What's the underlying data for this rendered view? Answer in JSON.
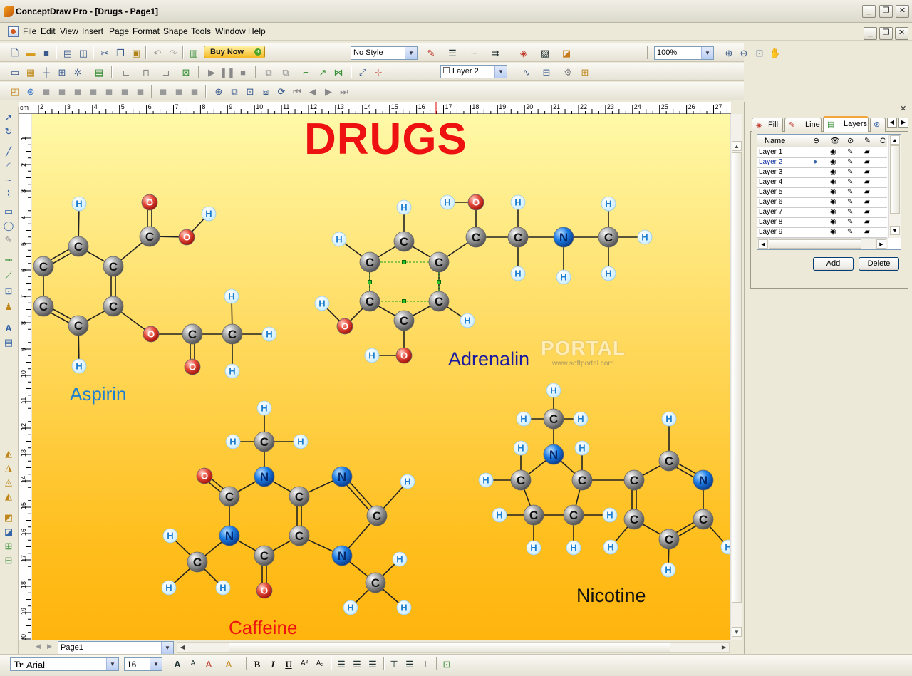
{
  "window": {
    "title": "ConceptDraw Pro - [Drugs - Page1]",
    "min": "_",
    "max": "❐",
    "close": "✕"
  },
  "menu": [
    "File",
    "Edit",
    "View",
    "Insert",
    "Page",
    "Format",
    "Shape",
    "Tools",
    "Window",
    "Help"
  ],
  "toolbar": {
    "buy_now": "Buy Now",
    "style_select": "No Style",
    "zoom_select": "100%",
    "layer_select": "Layer 2"
  },
  "font": {
    "family": "Arial",
    "size": "16"
  },
  "icons": {
    "bold": "B",
    "italic": "I",
    "underline": "U",
    "superscript": "A²",
    "subscript": "A₂"
  },
  "page_tab": "Page1",
  "ruler": {
    "unit": "cm",
    "top": [
      "2",
      "3",
      "4",
      "5",
      "6",
      "7",
      "8",
      "9",
      "10",
      "11",
      "12",
      "13",
      "14",
      "15",
      "16",
      "17",
      "18",
      "19",
      "20",
      "21",
      "22",
      "23",
      "24",
      "25",
      "26",
      "27"
    ],
    "left": [
      "1",
      "2",
      "3",
      "4",
      "5",
      "6",
      "7",
      "8",
      "9",
      "10",
      "11",
      "12",
      "13",
      "14",
      "15",
      "16",
      "17",
      "18",
      "19",
      "20"
    ]
  },
  "panel": {
    "tabs": [
      "Fill",
      "Line",
      "Layers"
    ],
    "columns": [
      "Name",
      "C"
    ],
    "layers": [
      "Layer 1",
      "Layer 2",
      "Layer 3",
      "Layer 4",
      "Layer 5",
      "Layer 6",
      "Layer 7",
      "Layer 8",
      "Layer 9"
    ],
    "active_layer": "Layer 2",
    "add": "Add",
    "delete": "Delete"
  },
  "diagram": {
    "title": "DRUGS",
    "watermark": "PORTAL",
    "watermark_url": "www.softportal.com",
    "labels": {
      "aspirin": "Aspirin",
      "adrenalin": "Adrenalin",
      "caffeine": "Caffeine",
      "nicotine": "Nicotine"
    },
    "colors": {
      "title": "#ee1111",
      "carbon": "#a9a9a9",
      "hydrogen": "#cfeeff",
      "oxygen": "#e74c3c",
      "nitrogen": "#1e7ee6",
      "aspirin": "#1e7fd0",
      "adrenalin": "#1a1aa0",
      "caffeine": "#ee1111",
      "nicotine": "#111111"
    }
  }
}
